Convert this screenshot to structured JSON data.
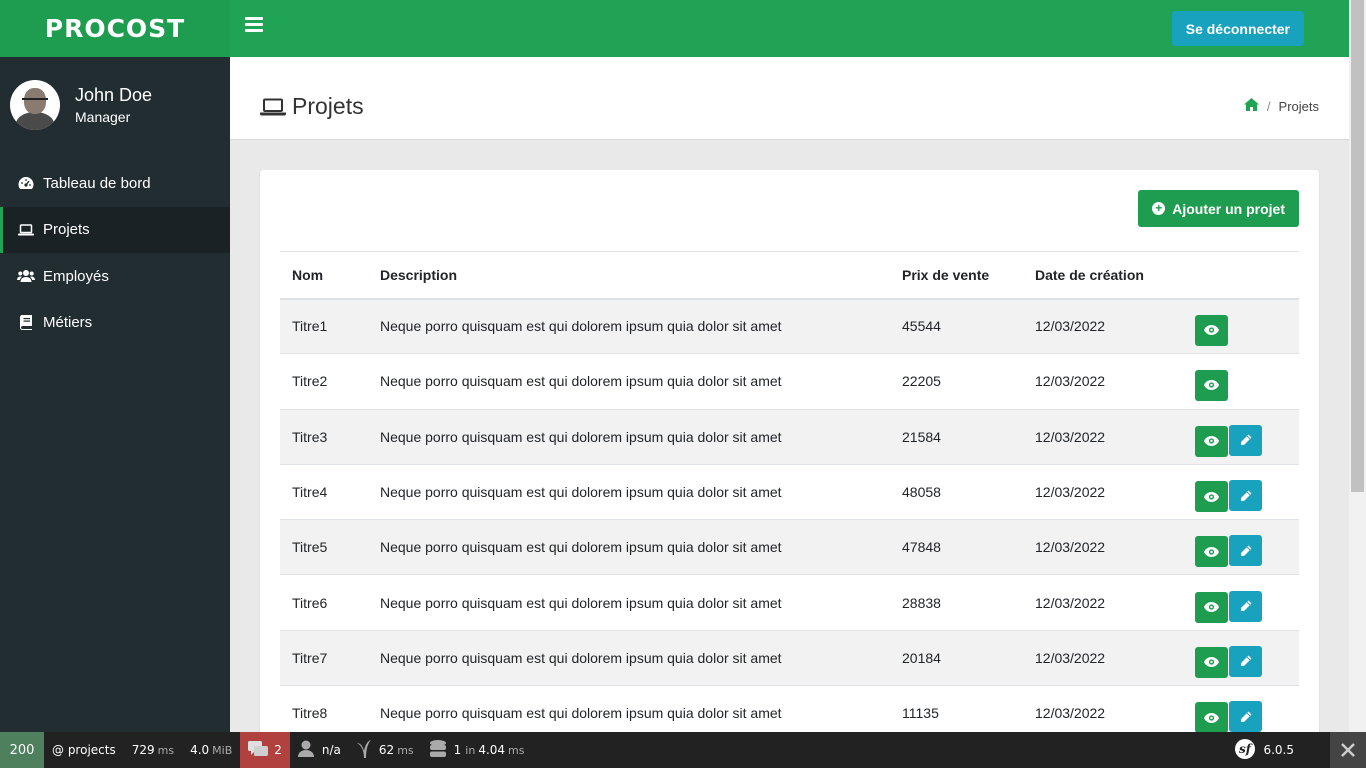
{
  "app": {
    "brand": "PROCOST"
  },
  "topbar": {
    "logout_label": "Se déconnecter"
  },
  "user": {
    "name": "John Doe",
    "role": "Manager"
  },
  "sidebar": {
    "items": [
      {
        "label": "Tableau de bord",
        "icon": "dashboard-icon"
      },
      {
        "label": "Projets",
        "icon": "laptop-icon",
        "active": true
      },
      {
        "label": "Employés",
        "icon": "users-icon"
      },
      {
        "label": "Métiers",
        "icon": "book-icon"
      }
    ]
  },
  "header": {
    "title": "Projets",
    "breadcrumb": {
      "home_icon": "home-icon",
      "current": "Projets"
    }
  },
  "toolbar": {
    "add_label": "Ajouter un projet"
  },
  "table": {
    "headers": [
      "Nom",
      "Description",
      "Prix de vente",
      "Date de création",
      ""
    ],
    "rows": [
      {
        "nom": "Titre1",
        "description": "Neque porro quisquam est qui dolorem ipsum quia dolor sit amet",
        "prix": "45544",
        "date": "12/03/2022",
        "editable": false
      },
      {
        "nom": "Titre2",
        "description": "Neque porro quisquam est qui dolorem ipsum quia dolor sit amet",
        "prix": "22205",
        "date": "12/03/2022",
        "editable": false
      },
      {
        "nom": "Titre3",
        "description": "Neque porro quisquam est qui dolorem ipsum quia dolor sit amet",
        "prix": "21584",
        "date": "12/03/2022",
        "editable": true
      },
      {
        "nom": "Titre4",
        "description": "Neque porro quisquam est qui dolorem ipsum quia dolor sit amet",
        "prix": "48058",
        "date": "12/03/2022",
        "editable": true
      },
      {
        "nom": "Titre5",
        "description": "Neque porro quisquam est qui dolorem ipsum quia dolor sit amet",
        "prix": "47848",
        "date": "12/03/2022",
        "editable": true
      },
      {
        "nom": "Titre6",
        "description": "Neque porro quisquam est qui dolorem ipsum quia dolor sit amet",
        "prix": "28838",
        "date": "12/03/2022",
        "editable": true
      },
      {
        "nom": "Titre7",
        "description": "Neque porro quisquam est qui dolorem ipsum quia dolor sit amet",
        "prix": "20184",
        "date": "12/03/2022",
        "editable": true
      },
      {
        "nom": "Titre8",
        "description": "Neque porro quisquam est qui dolorem ipsum quia dolor sit amet",
        "prix": "11135",
        "date": "12/03/2022",
        "editable": true
      }
    ]
  },
  "debugbar": {
    "status": "200",
    "route": "@ projects",
    "time": "729",
    "time_unit": "ms",
    "memory": "4.0",
    "memory_unit": "MiB",
    "logs": "2",
    "user": "n/a",
    "twig_time": "62",
    "twig_unit": "ms",
    "db_queries": "1",
    "db_in": "in",
    "db_time": "4.04",
    "db_unit": "ms",
    "version": "6.0.5"
  },
  "colors": {
    "primary": "#21a356",
    "brand": "#1e9c4f",
    "info": "#19a2bd",
    "sidebar": "#222d32"
  }
}
